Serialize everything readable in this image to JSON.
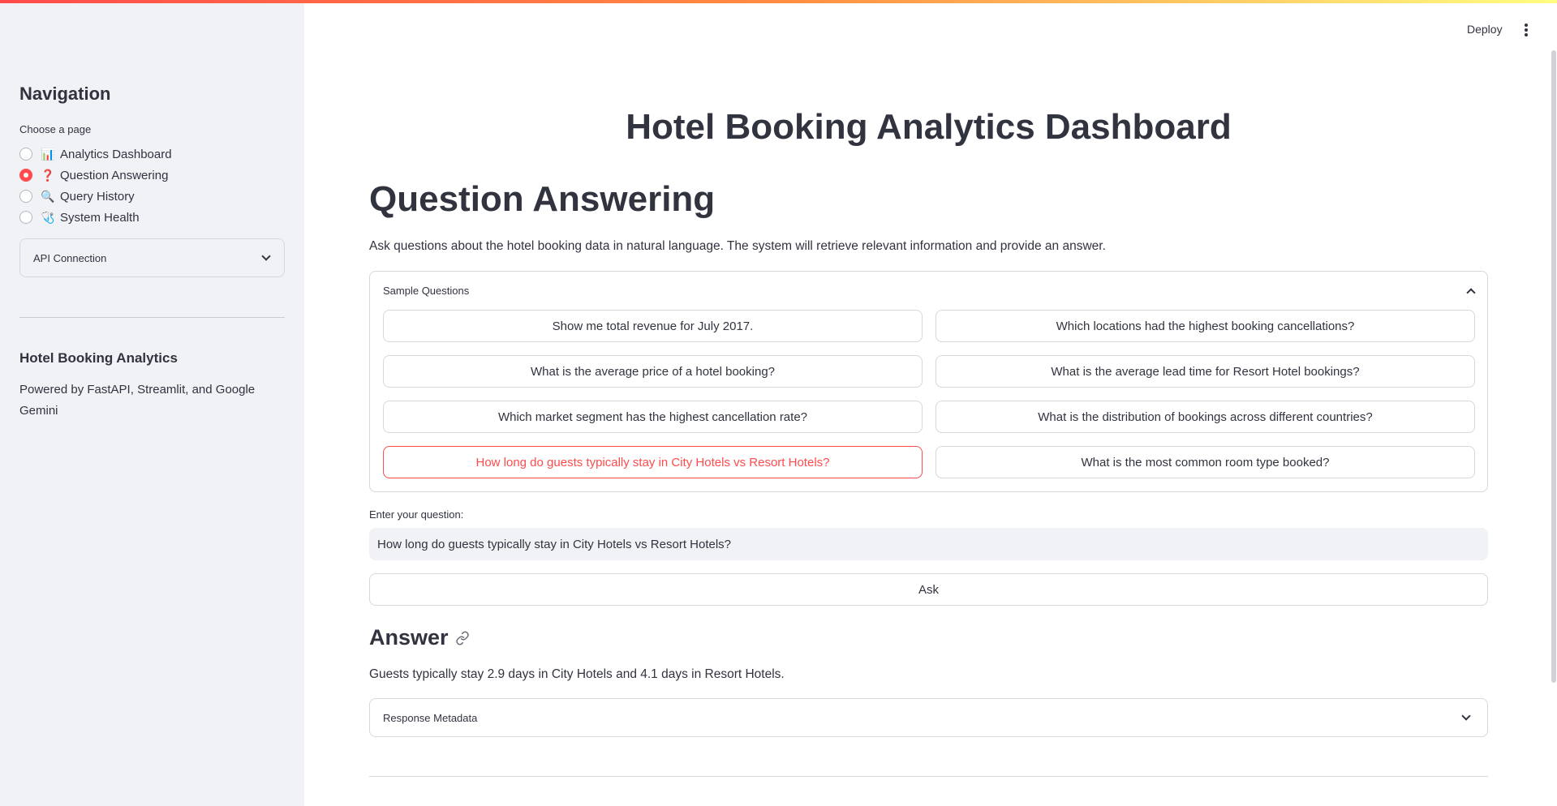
{
  "sidebar": {
    "nav_title": "Navigation",
    "choose_label": "Choose a page",
    "pages": [
      {
        "emoji": "📊",
        "label": "Analytics Dashboard",
        "selected": false
      },
      {
        "emoji": "❓",
        "label": "Question Answering",
        "selected": true
      },
      {
        "emoji": "🔍",
        "label": "Query History",
        "selected": false
      },
      {
        "emoji": "🩺",
        "label": "System Health",
        "selected": false
      }
    ],
    "api_expander_label": "API Connection",
    "app_title": "Hotel Booking Analytics",
    "powered_by": "Powered by FastAPI, Streamlit, and Google Gemini"
  },
  "header": {
    "deploy_label": "Deploy",
    "menu_icon": "kebab-menu-icon"
  },
  "main": {
    "title": "Hotel Booking Analytics Dashboard",
    "section_title": "Question Answering",
    "description": "Ask questions about the hotel booking data in natural language. The system will retrieve relevant information and provide an answer.",
    "sample_header": "Sample Questions",
    "sample_questions": [
      "Show me total revenue for July 2017.",
      "Which locations had the highest booking cancellations?",
      "What is the average price of a hotel booking?",
      "What is the average lead time for Resort Hotel bookings?",
      "Which market segment has the highest cancellation rate?",
      "What is the distribution of bookings across different countries?",
      "How long do guests typically stay in City Hotels vs Resort Hotels?",
      "What is the most common room type booked?"
    ],
    "active_sample_index": 6,
    "input_label": "Enter your question:",
    "input_value": "How long do guests typically stay in City Hotels vs Resort Hotels?",
    "ask_label": "Ask",
    "answer_title": "Answer",
    "answer_text": "Guests typically stay 2.9 days in City Hotels and 4.1 days in Resort Hotels.",
    "metadata_label": "Response Metadata"
  },
  "colors": {
    "accent": "#ff4b4b",
    "sidebar_bg": "#f0f2f6",
    "text": "#31333f",
    "border": "#d6d8de"
  }
}
